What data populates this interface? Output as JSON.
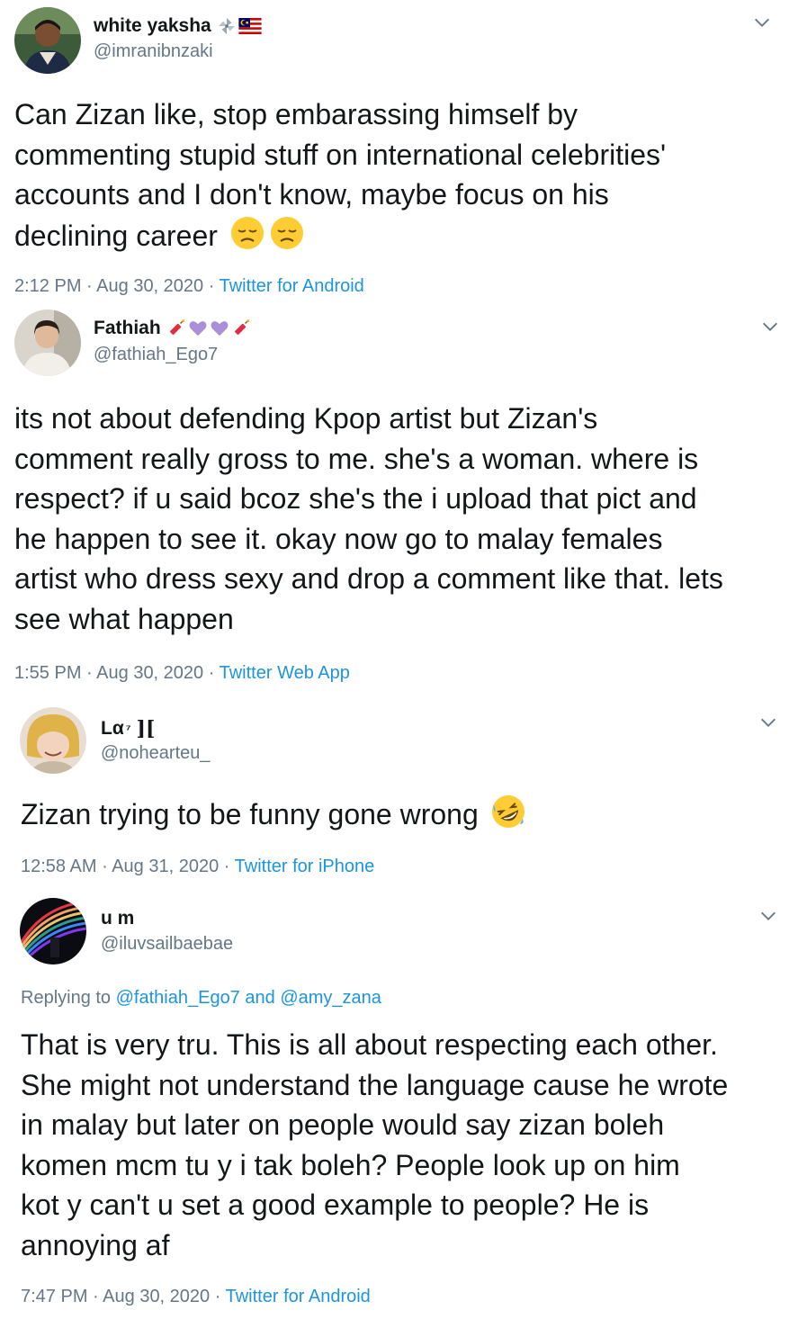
{
  "tweets": [
    {
      "display_name": "white yaksha",
      "handle": "@imranibnzaki",
      "name_icons": [
        "pinwheel-icon",
        "malaysia-flag-icon"
      ],
      "lines": [
        "Can Zizan like, stop embarassing himself by",
        "commenting stupid stuff on international celebrities'",
        "accounts and I don't know, maybe focus on his",
        "declining career"
      ],
      "trailing_emoji": [
        "disappointed-face-icon",
        "disappointed-face-icon"
      ],
      "time": "2:12 PM",
      "date": "Aug 30, 2020",
      "source": "Twitter for Android"
    },
    {
      "display_name": "Fathiah",
      "handle": "@fathiah_Ego7",
      "name_icons": [
        "firecracker-icon",
        "purple-heart-icon",
        "purple-heart-icon",
        "firecracker-icon"
      ],
      "lines": [
        "its not about defending Kpop artist but Zizan's",
        "comment really gross to me. she's a woman. where is",
        "respect? if u said bcoz she's the i upload that pict and",
        "he happen to see it. okay now go to malay females",
        "artist who dress sexy and drop a comment like that. lets",
        "see what happen"
      ],
      "time": "1:55 PM",
      "date": "Aug 30, 2020",
      "source": "Twitter Web App"
    },
    {
      "display_name": "Lα",
      "name_suffix": "⁷",
      "name_mark": "][",
      "handle": "@nohearteu_",
      "lines": [
        "Zizan trying to be funny gone wrong"
      ],
      "trailing_emoji": [
        "rolling-laughing-face-icon"
      ],
      "time": "12:58 AM",
      "date": "Aug 31, 2020",
      "source": "Twitter for iPhone"
    },
    {
      "display_name": "u m",
      "handle": "@iluvsailbaebae",
      "replying_prefix": "Replying to",
      "replying_to": [
        "@fathiah_Ego7",
        "@amy_zana"
      ],
      "replying_joiner": "and",
      "lines": [
        "That is very tru. This is all about respecting each other.",
        "She might not understand the language cause he wrote",
        "in malay but later on people would say zizan boleh",
        "komen mcm tu y i tak boleh? People look up on him",
        "kot y can't u set a good example to people? He is",
        "annoying af"
      ],
      "time": "7:47 PM",
      "date": "Aug 30, 2020",
      "source": "Twitter for Android"
    }
  ],
  "separator": "·",
  "colors": {
    "text": "#14171a",
    "secondary": "#657786",
    "link": "#1b95e0",
    "background": "#ffffff"
  }
}
